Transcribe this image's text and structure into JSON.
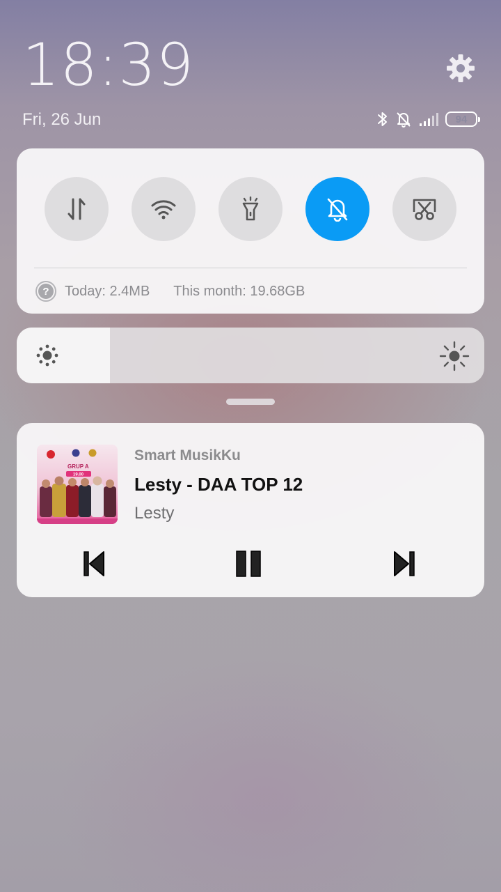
{
  "header": {
    "time": "18:39",
    "date": "Fri, 26 Jun",
    "battery_level": "94",
    "icons": [
      "gear-icon",
      "bluetooth-icon",
      "bell-off-icon",
      "signal-icon",
      "battery-icon"
    ]
  },
  "quick_settings": {
    "toggles": [
      {
        "name": "mobile-data",
        "icon": "arrows-up-down-icon",
        "active": false
      },
      {
        "name": "wifi",
        "icon": "wifi-icon",
        "active": false
      },
      {
        "name": "flashlight",
        "icon": "flashlight-icon",
        "active": false
      },
      {
        "name": "silent",
        "icon": "bell-off-icon",
        "active": true
      },
      {
        "name": "screenshot",
        "icon": "scissors-icon",
        "active": false
      }
    ],
    "active_color": "#0a9bf5",
    "usage_today": "Today: 2.4MB",
    "usage_month": "This month: 19.68GB"
  },
  "brightness": {
    "level": 0.2
  },
  "media": {
    "app_name": "Smart MusikKu",
    "title": "Lesty - DAA TOP 12",
    "artist": "Lesty",
    "artwork_texts": [
      "GRUP A",
      "19.00"
    ],
    "controls": [
      "previous",
      "pause",
      "next"
    ]
  }
}
